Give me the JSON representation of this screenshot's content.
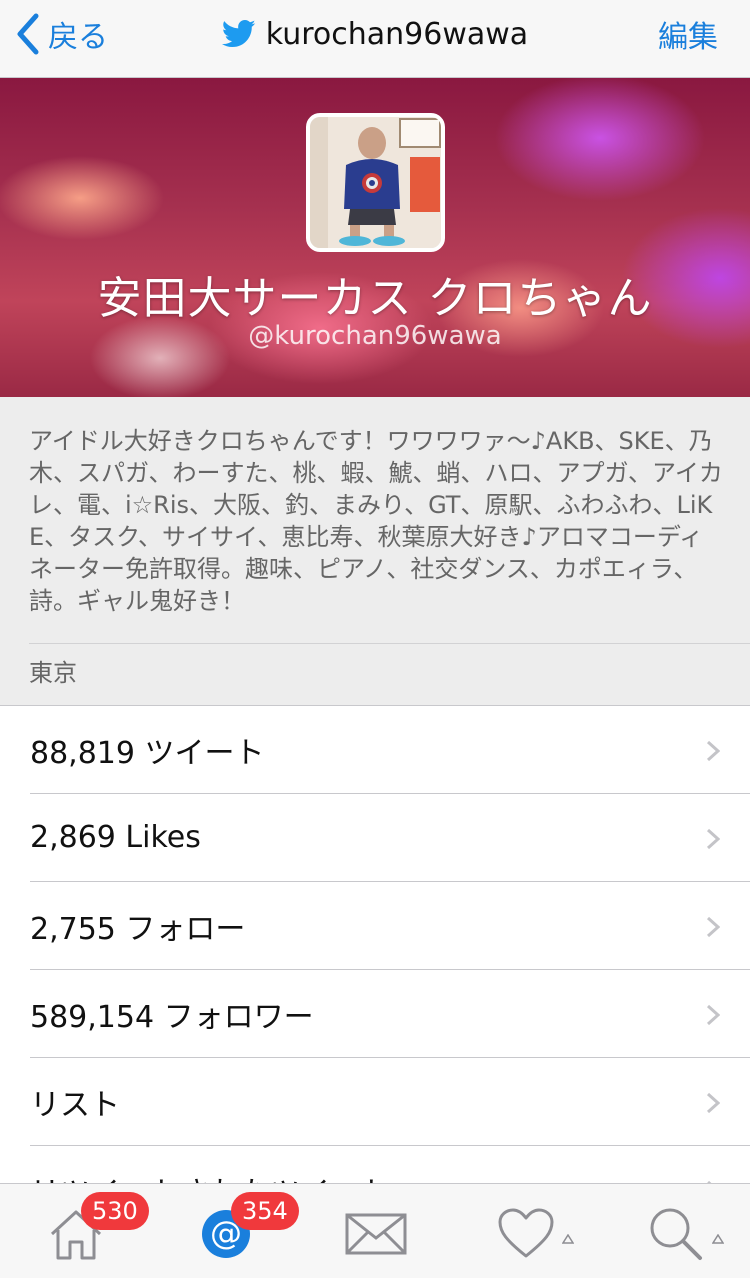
{
  "nav": {
    "back_label": "戻る",
    "title": "kurochan96wawa",
    "edit_label": "編集"
  },
  "profile": {
    "display_name": "安田大サーカス クロちゃん",
    "handle": "@kurochan96wawa",
    "bio": "アイドル大好きクロちゃんです！ワワワワァ〜♪AKB、SKE、乃木、スパガ、わーすた、桃、蝦、鯱、蛸、ハロ、アプガ、アイカレ、電、i☆Ris、大阪、釣、まみり、GT、原駅、ふわふわ、LiKE、タスク、サイサイ、恵比寿、秋葉原大好き♪アロマコーディネーター免許取得。趣味、ピアノ、社交ダンス、カポエィラ、詩。ギャル鬼好き！",
    "location": "東京"
  },
  "stats": [
    {
      "label": "88,819 ツイート"
    },
    {
      "label": "2,869 Likes"
    },
    {
      "label": "2,755 フォロー"
    },
    {
      "label": "589,154 フォロワー"
    },
    {
      "label": "リスト"
    },
    {
      "label": "リツイートされたツイート"
    }
  ],
  "tabbar": {
    "home_badge": "530",
    "mentions_badge": "354",
    "icons": [
      "home-icon",
      "mentions-icon",
      "messages-icon",
      "likes-icon",
      "search-icon"
    ]
  },
  "colors": {
    "accent": "#1a7fdc",
    "badge": "#f0393c"
  }
}
